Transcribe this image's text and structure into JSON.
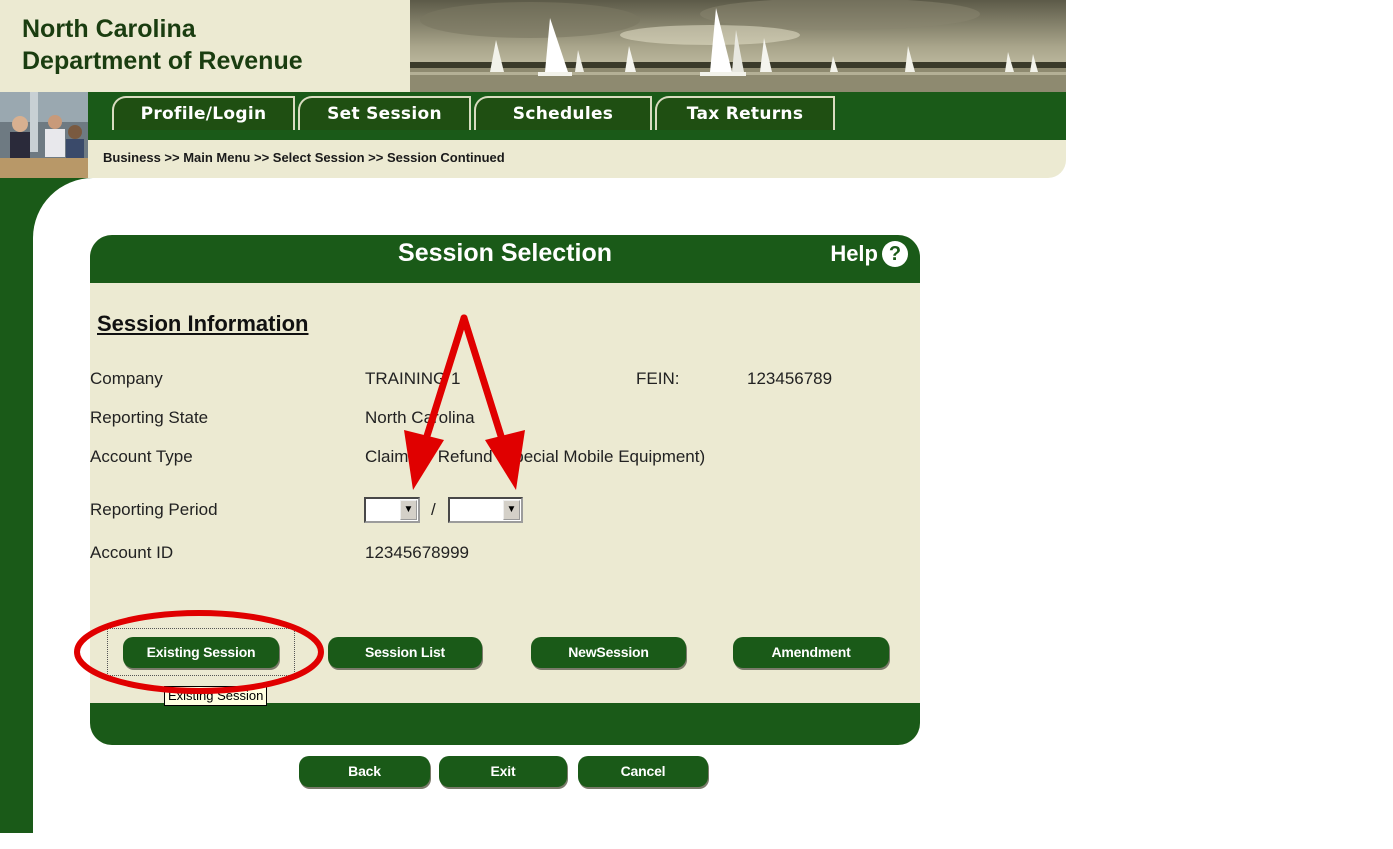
{
  "header": {
    "org_line1": "North Carolina",
    "org_line2": "Department of Revenue"
  },
  "nav": {
    "tabs": [
      {
        "label": "Profile/Login"
      },
      {
        "label": "Set Session"
      },
      {
        "label": "Schedules"
      },
      {
        "label": "Tax Returns"
      }
    ]
  },
  "breadcrumb": "Business >> Main Menu >> Select Session >> Session Continued",
  "panel": {
    "title": "Session Selection",
    "help_label": "Help",
    "help_glyph": "?",
    "section_title": "Session Information",
    "fields": {
      "company_label": "Company",
      "company_value": "TRAINING 1",
      "fein_label": "FEIN:",
      "fein_value": "123456789",
      "state_label": "Reporting State",
      "state_value": "North Carolina",
      "account_type_label": "Account Type",
      "account_type_value": "Claim for Refund (Special Mobile Equipment)",
      "period_label": "Reporting Period",
      "period_separator": "/",
      "period_month": "",
      "period_year": "",
      "account_id_label": "Account ID",
      "account_id_value": "12345678999"
    },
    "buttons": {
      "existing_session": "Existing Session",
      "session_list": "Session List",
      "new_session": "NewSession",
      "amendment": "Amendment"
    },
    "tooltip": "Existing Session"
  },
  "footer_buttons": {
    "back": "Back",
    "exit": "Exit",
    "cancel": "Cancel"
  },
  "colors": {
    "brand_green": "#1a5a18",
    "panel_bg": "#ecead2",
    "annotation_red": "#e00000"
  }
}
